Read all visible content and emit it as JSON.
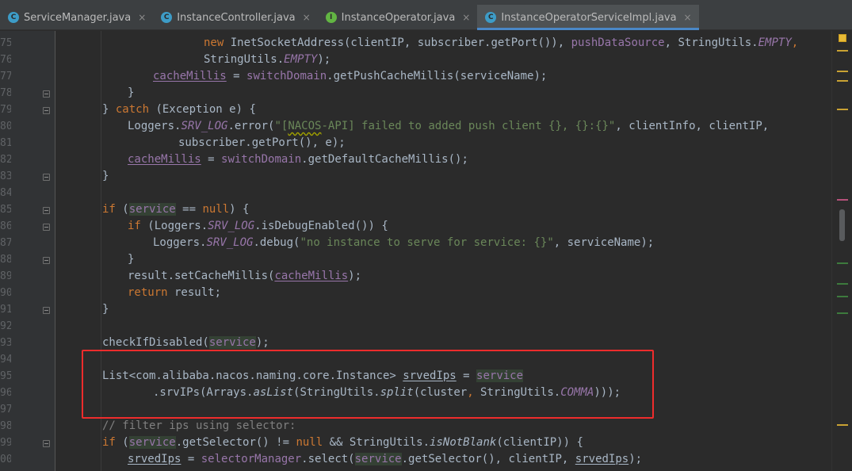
{
  "tabs": [
    {
      "label": "ServiceManager.java",
      "icon": "class-icon",
      "active": false
    },
    {
      "label": "InstanceController.java",
      "icon": "class-icon",
      "active": false
    },
    {
      "label": "InstanceOperator.java",
      "icon": "interface-icon",
      "active": false
    },
    {
      "label": "InstanceOperatorServiceImpl.java",
      "icon": "class-icon",
      "active": true
    }
  ],
  "tab_icon_letters": {
    "class": "C",
    "interface": "I"
  },
  "close_glyph": "×",
  "line_numbers": [
    "75",
    "76",
    "77",
    "78",
    "79",
    "80",
    "81",
    "82",
    "83",
    "84",
    "85",
    "86",
    "87",
    "88",
    "89",
    "90",
    "91",
    "92",
    "93",
    "94",
    "95",
    "96",
    "97",
    "98",
    "99",
    "00"
  ],
  "code": {
    "l75": {
      "t1": "new ",
      "t2": "InetSocketAddress(clientIP, subscriber.getPort()), ",
      "t3": "pushDataSource",
      "t4": ", StringUtils.",
      "t5": "EMPTY",
      "t6": ","
    },
    "l76": {
      "t1": "StringUtils.",
      "t2": "EMPTY",
      "t3": ");"
    },
    "l77": {
      "t1": "cacheMillis",
      "t2": " = ",
      "t3": "switchDomain",
      "t4": ".getPushCacheMillis(serviceName);"
    },
    "l78": {
      "t1": "}"
    },
    "l79": {
      "t1": "} ",
      "t2": "catch",
      "t3": " (Exception e) {"
    },
    "l80": {
      "t1": "Loggers.",
      "t2": "SRV_LOG",
      "t3": ".error(",
      "t4": "\"[",
      "t5": "NACOS",
      "t6": "-API] failed to added push client {}, {}:{}\"",
      "t7": ", clientInfo, clientIP,"
    },
    "l81": {
      "t1": "subscriber.getPort(), e);"
    },
    "l82": {
      "t1": "cacheMillis",
      "t2": " = ",
      "t3": "switchDomain",
      "t4": ".getDefaultCacheMillis();"
    },
    "l83": {
      "t1": "}"
    },
    "l85": {
      "t1": "if",
      "t2": " (",
      "t3": "service",
      "t4": " == ",
      "t5": "null",
      "t6": ") {"
    },
    "l86": {
      "t1": "if",
      "t2": " (Loggers.",
      "t3": "SRV_LOG",
      "t4": ".isDebugEnabled()) {"
    },
    "l87": {
      "t1": "Loggers.",
      "t2": "SRV_LOG",
      "t3": ".debug(",
      "t4": "\"no instance to serve for service: {}\"",
      "t5": ", serviceName);"
    },
    "l88": {
      "t1": "}"
    },
    "l89": {
      "t1": "result.setCacheMillis(",
      "t2": "cacheMillis",
      "t3": ");"
    },
    "l90": {
      "t1": "return",
      "t2": " result;"
    },
    "l91": {
      "t1": "}"
    },
    "l93": {
      "t1": "checkIfDisabled(",
      "t2": "service",
      "t3": ");"
    },
    "l95": {
      "t1": "List<com.alibaba.nacos.naming.core.Instance> ",
      "t2": "srvedIps",
      "t3": " = ",
      "t4": "service"
    },
    "l96": {
      "t1": ".srvIPs(Arrays.",
      "t2": "asList",
      "t3": "(StringUtils.",
      "t4": "split",
      "t5": "(cluster",
      "t6": ", ",
      "t7": "StringUtils.",
      "t8": "COMMA",
      "t9": ")));"
    },
    "l98": {
      "t1": "// filter ips using selector:"
    },
    "l99": {
      "t1": "if",
      "t2": " (",
      "t3": "service",
      "t4": ".getSelector() != ",
      "t5": "null",
      "t6": " && StringUtils.",
      "t7": "isNotBlank",
      "t8": "(clientIP)) {"
    },
    "l100": {
      "t1": "srvedIps",
      "t2": " = ",
      "t3": "selectorManager",
      "t4": ".select(",
      "t5": "service",
      "t6": ".getSelector(), clientIP, ",
      "t7": "srvedIps",
      "t8": ");"
    }
  },
  "colors": {
    "keyword": "#cc7832",
    "string": "#6a8759",
    "field": "#9876aa",
    "comment": "#808080",
    "highlight_box": "#ee2c2c",
    "active_tab_underline": "#4a88c7"
  }
}
